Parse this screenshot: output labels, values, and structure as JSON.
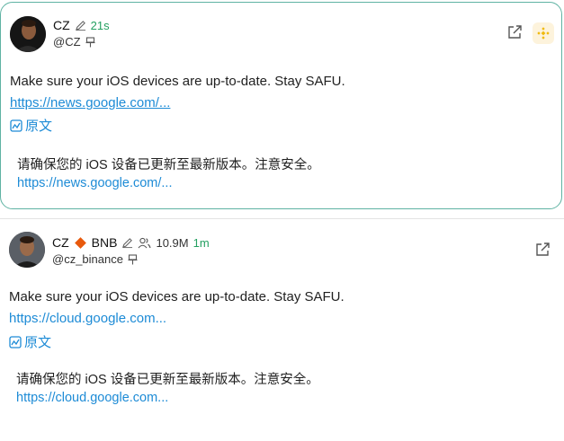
{
  "posts": [
    {
      "author": "CZ",
      "handle": "@CZ",
      "time": "21s",
      "text": "Make sure your iOS devices are up-to-date. Stay SAFU.",
      "link": "https://news.google.com/...",
      "translate_label": "原文",
      "translation": "请确保您的 iOS 设备已更新至最新版本。注意安全。",
      "translation_link": "https://news.google.com/..."
    },
    {
      "author": "CZ",
      "badge_label": "BNB",
      "followers": "10.9M",
      "handle": "@cz_binance",
      "time": "1m",
      "text": "Make sure your iOS devices are up-to-date. Stay SAFU.",
      "link": "https://cloud.google.com...",
      "translate_label": "原文",
      "translation": "请确保您的 iOS 设备已更新至最新版本。注意安全。",
      "translation_link": "https://cloud.google.com..."
    }
  ],
  "colors": {
    "accent_green": "#24a061",
    "link_blue": "#1d8bd6",
    "card_border": "#5fb3a3",
    "bnb_orange": "#e8590c"
  },
  "icons": [
    "pencil-icon",
    "pin-icon",
    "external-link-icon",
    "bnb-logo-icon",
    "translate-icon",
    "users-icon",
    "orange-diamond-icon"
  ]
}
